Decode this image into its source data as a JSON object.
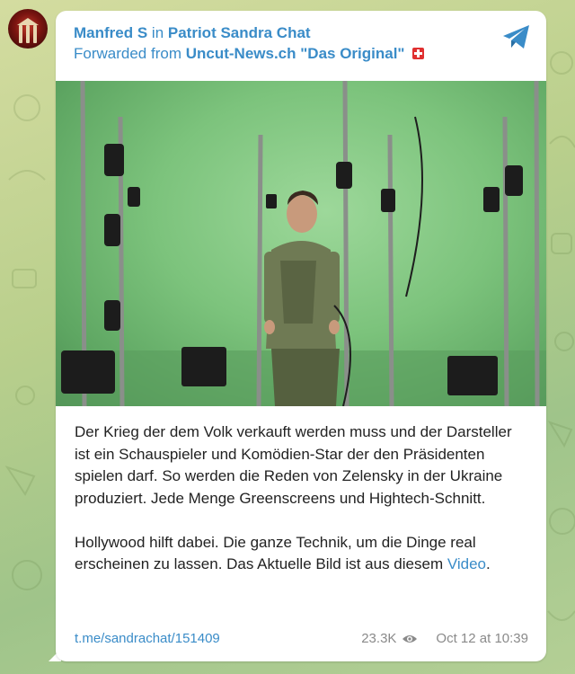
{
  "message": {
    "author": "Manfred S",
    "in_word": "in",
    "chat": "Patriot Sandra Chat",
    "forwarded_prefix": "Forwarded from",
    "forwarded_source": "Uncut-News.ch \"Das Original\"",
    "paragraph1": "Der Krieg der dem Volk verkauft werden muss und der Darsteller ist ein Schauspieler und Komödien-Star der den Präsidenten spielen darf. So werden die Reden von Zelensky in der Ukraine produziert. Jede Menge Greenscreens und Hightech-Schnitt.",
    "paragraph2_text": "Hollywood hilft dabei. Die ganze Technik, um die Dinge real erscheinen zu lassen. Das Aktuelle Bild ist aus diesem",
    "paragraph2_link": "Video",
    "paragraph2_end": ".",
    "link": "t.me/sandrachat/151409",
    "views": "23.3K",
    "timestamp": "Oct 12 at 10:39"
  },
  "icons": {
    "telegram": "telegram-plane-icon",
    "views": "eye-icon",
    "flag": "swiss-flag-icon"
  },
  "colors": {
    "accent": "#3a8cc8",
    "text": "#222222",
    "meta": "#8a8a8a",
    "green_screen": "#7cc37c"
  }
}
